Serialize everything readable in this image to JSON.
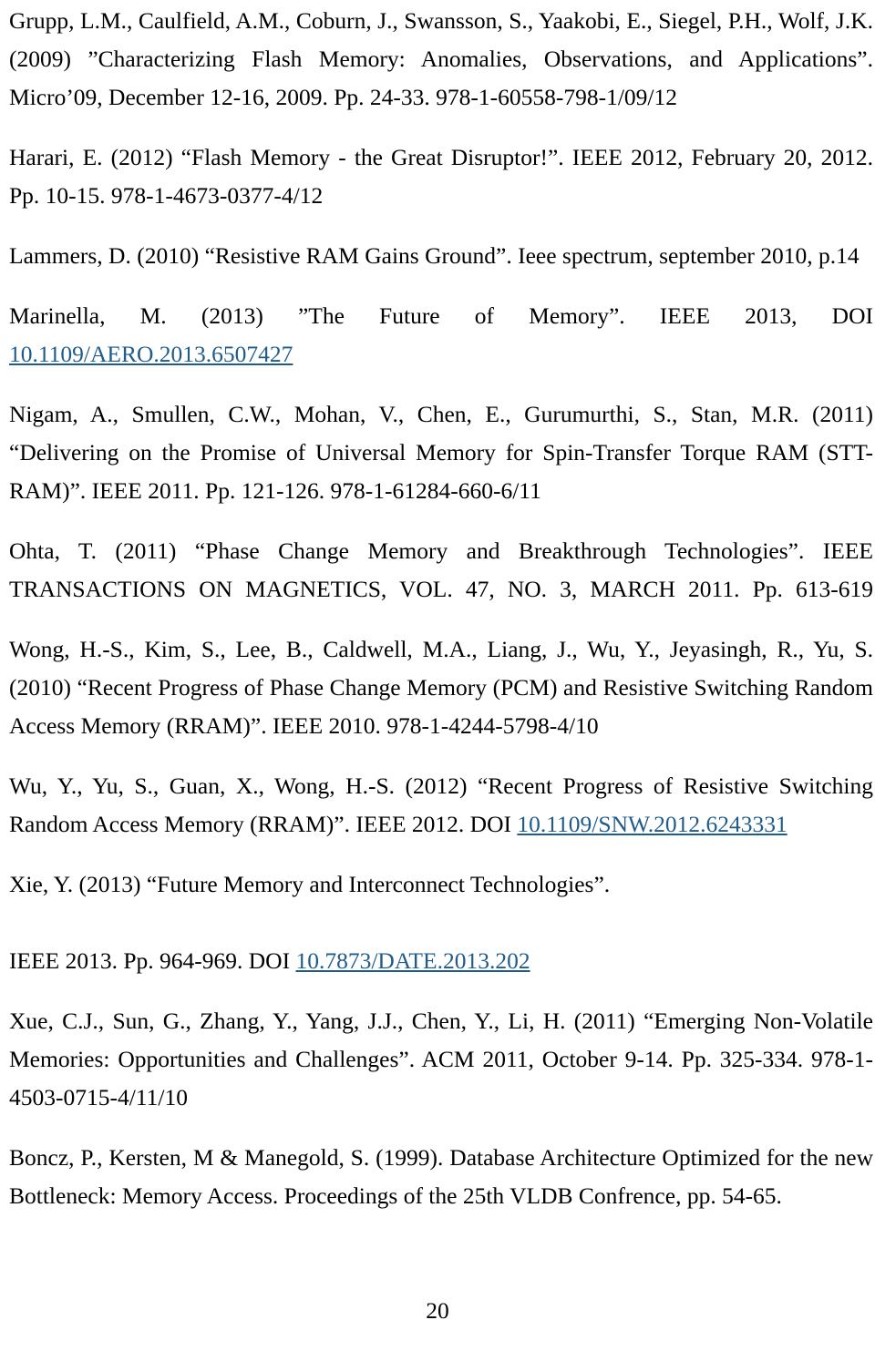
{
  "document": {
    "type": "references-page",
    "page_number": "20",
    "link_color": "#1f5c8b",
    "text_color": "#000000",
    "background_color": "#ffffff"
  },
  "references": [
    {
      "id": "grupp-2009",
      "text": "Grupp, L.M., Caulfield, A.M., Coburn, J., Swansson, S., Yaakobi, E., Siegel, P.H., Wolf, J.K. (2009) ”Characterizing Flash Memory: Anomalies, Observations, and Applications”. Micro’09, December 12-16, 2009. Pp. 24-33. 978-1-60558-798-1/09/12"
    },
    {
      "id": "harari-2012",
      "text": "Harari, E. (2012) “Flash Memory - the Great Disruptor!”. IEEE 2012, February 20, 2012. Pp. 10-15. 978-1-4673-0377-4/12"
    },
    {
      "id": "lammers-2010",
      "text": "Lammers, D. (2010) “Resistive RAM Gains Ground”. Ieee spectrum, september 2010, p.14"
    },
    {
      "id": "marinella-2013",
      "prefix": "Marinella, M. (2013) ”The Future of Memory”. IEEE 2013, DOI ",
      "link": "10.1109/AERO.2013.6507427",
      "suffix": ""
    },
    {
      "id": "nigam-2011",
      "text": "Nigam, A., Smullen, C.W., Mohan, V., Chen, E., Gurumurthi, S., Stan, M.R. (2011) “Delivering on the Promise of Universal Memory for Spin-Transfer Torque RAM (STT-RAM)”. IEEE 2011. Pp. 121-126. 978-1-61284-660-6/11"
    },
    {
      "id": "ohta-2011",
      "text": "Ohta, T. (2011) “Phase Change Memory and Breakthrough Technologies”. IEEE TRANSACTIONS ON MAGNETICS, VOL. 47, NO. 3, MARCH 2011. Pp. 613-619"
    },
    {
      "id": "wong-2010",
      "text": "Wong, H.-S., Kim, S., Lee, B., Caldwell, M.A., Liang, J., Wu, Y., Jeyasingh, R., Yu, S. (2010) “Recent Progress of Phase Change Memory (PCM) and Resistive Switching Random Access Memory (RRAM)”. IEEE 2010. 978-1-4244-5798-4/10"
    },
    {
      "id": "wu-2012",
      "prefix": "Wu, Y., Yu, S., Guan, X., Wong, H.-S. (2012) “Recent Progress of Resistive Switching Random Access Memory (RRAM)”. IEEE 2012. DOI ",
      "link": "10.1109/SNW.2012.6243331",
      "suffix": ""
    },
    {
      "id": "xie-2013",
      "prefix": "Xie, Y. (2013) “Future Memory and Interconnect Technologies”.",
      "line2_prefix": "IEEE 2013. Pp. 964-969. DOI ",
      "link": "10.7873/DATE.2013.202",
      "suffix": ""
    },
    {
      "id": "xue-2011",
      "text": "Xue, C.J., Sun, G., Zhang, Y., Yang, J.J., Chen, Y., Li, H. (2011) “Emerging Non-Volatile Memories: Opportunities and Challenges”.  ACM 2011, October 9-14. Pp. 325-334. 978-1-4503-0715-4/11/10"
    },
    {
      "id": "boncz-1999",
      "text": "Boncz, P., Kersten, M & Manegold, S. (1999). Database Architecture Optimized for the new Bottleneck: Memory Access. Proceedings of the 25th VLDB Confrence, pp. 54-65."
    }
  ]
}
